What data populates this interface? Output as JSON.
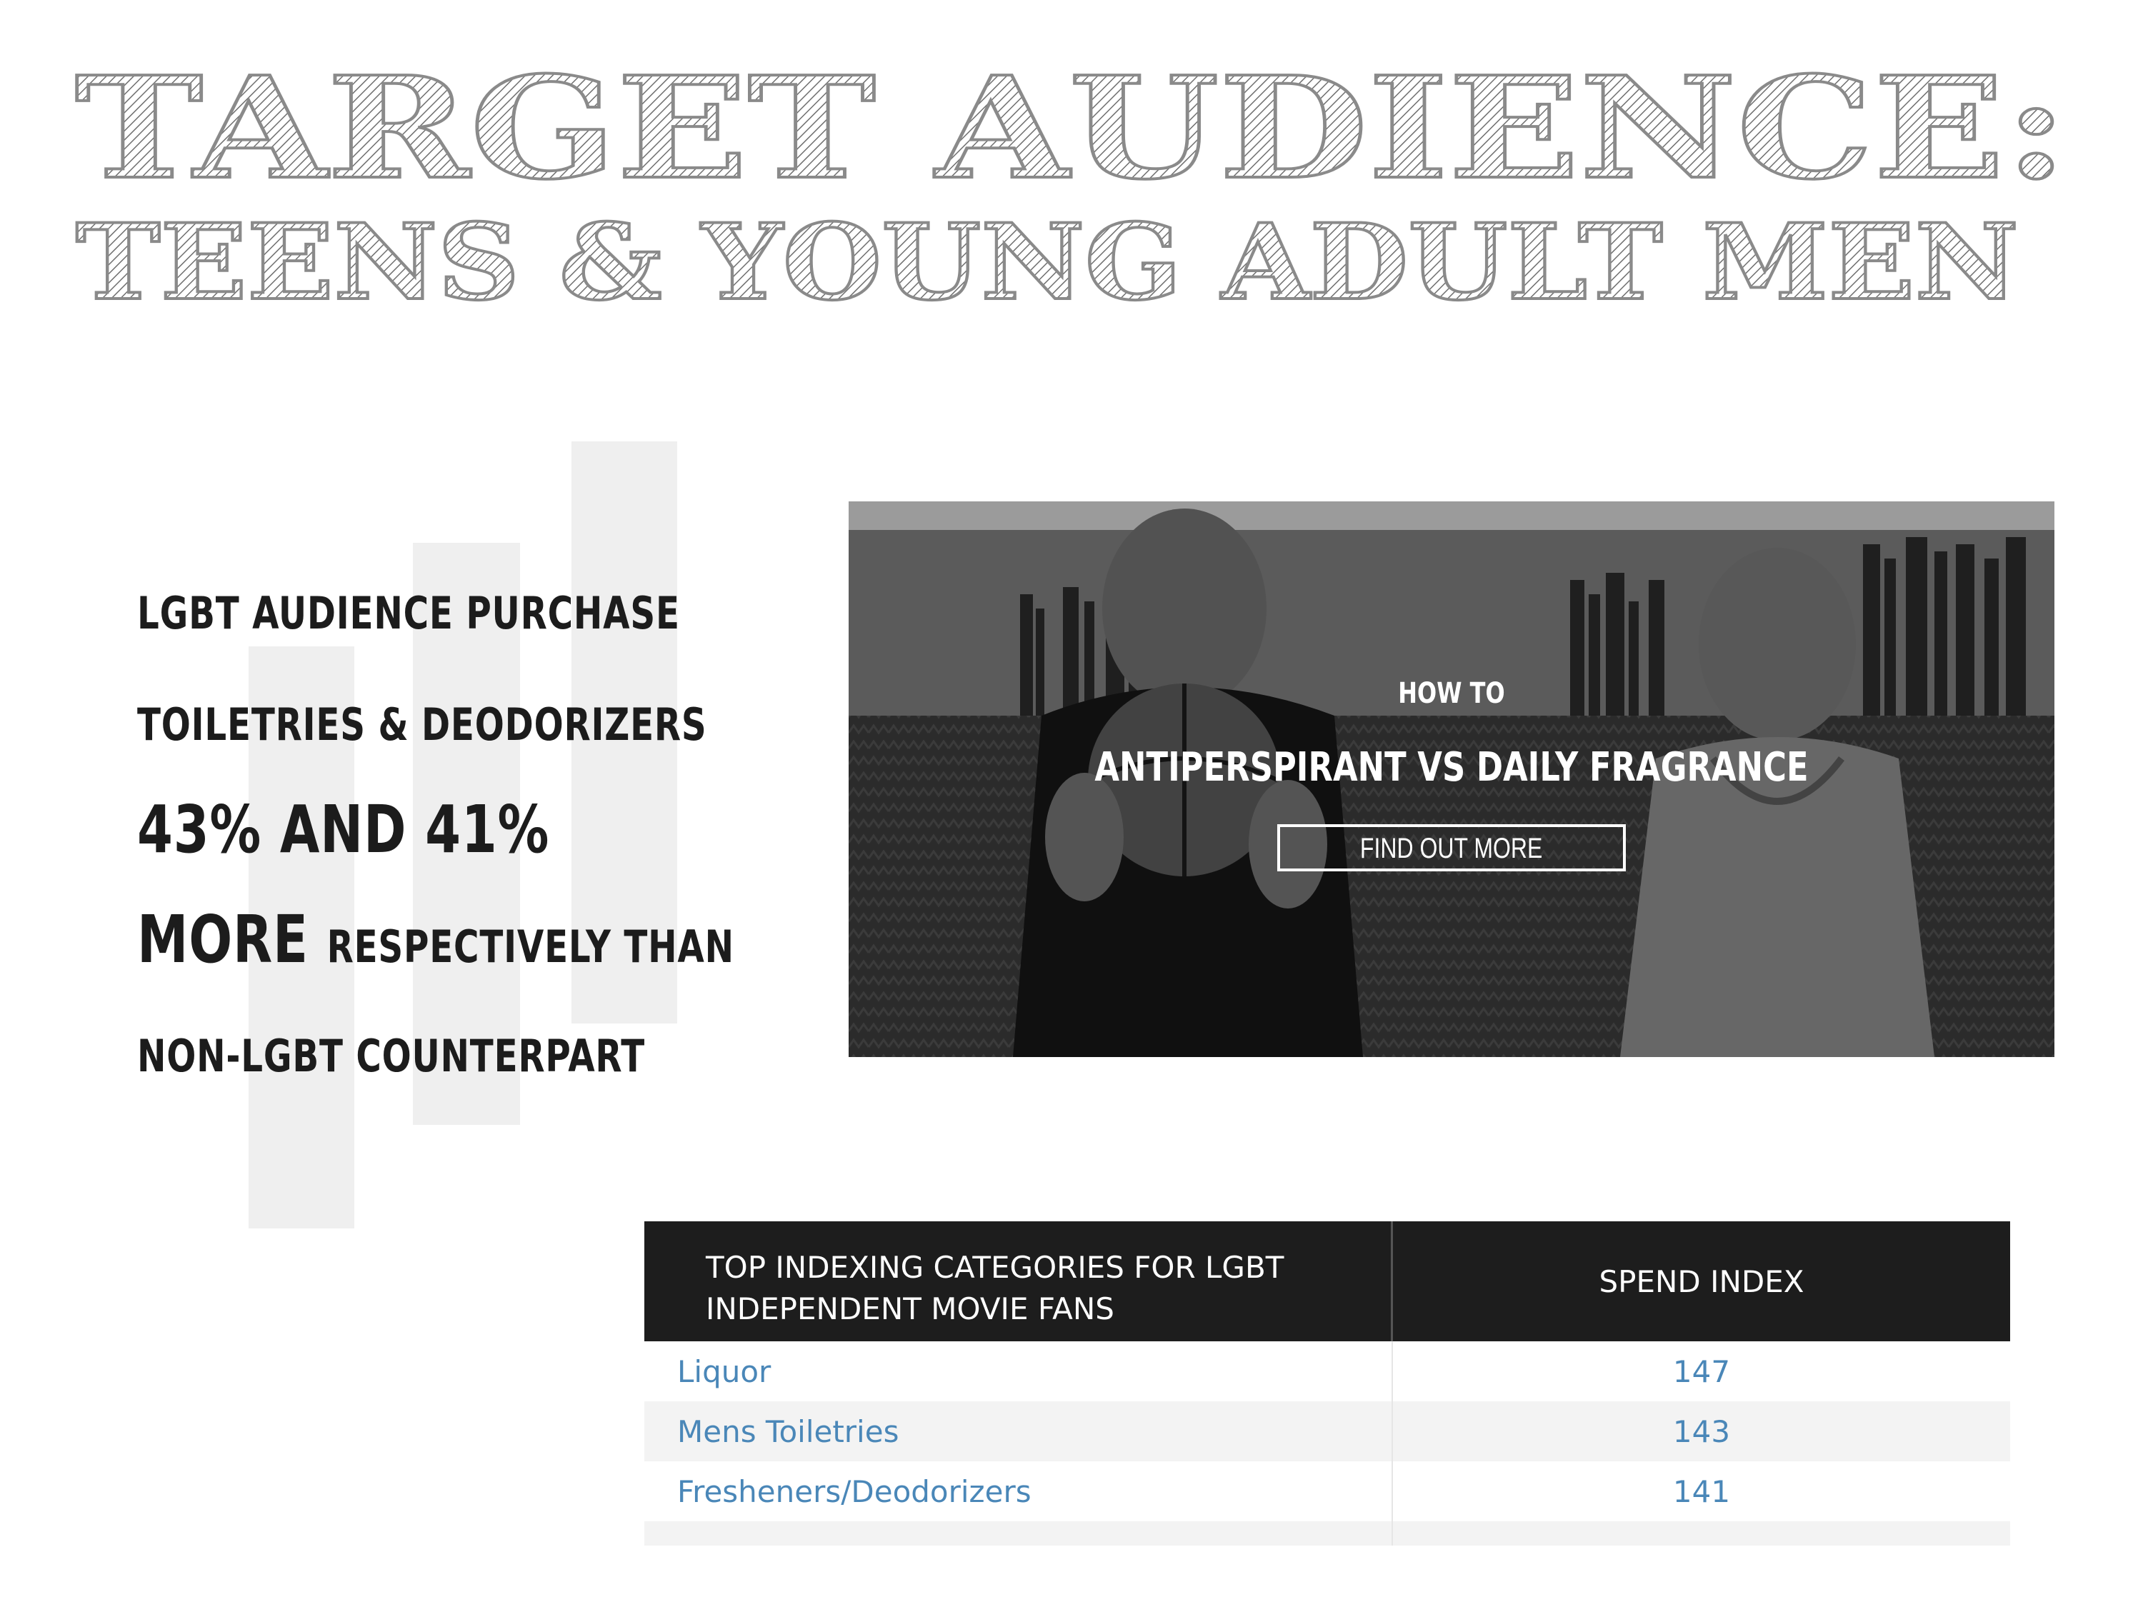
{
  "title": {
    "line1": "TARGET AUDIENCE:",
    "line2": "TEENS & YOUNG ADULT MEN"
  },
  "stat": {
    "line1": "LGBT AUDIENCE PURCHASE",
    "line2": "TOILETRIES & DEODORIZERS",
    "line3": "43% AND 41%",
    "line4_big": "MORE",
    "line4_small": "RESPECTIVELY THAN",
    "line5": "NON-LGBT COUNTERPART"
  },
  "banner": {
    "kicker": "HOW TO",
    "headline": "ANTIPERSPIRANT VS DAILY FRAGRANCE",
    "button_label": "FIND OUT MORE"
  },
  "table": {
    "header_category": "TOP INDEXING CATEGORIES FOR LGBT INDEPENDENT MOVIE FANS",
    "header_category_line1": "TOP INDEXING CATEGORIES FOR LGBT",
    "header_category_line2": "INDEPENDENT MOVIE FANS",
    "header_index": "SPEND INDEX",
    "rows": [
      {
        "category": "Liquor",
        "index": "147"
      },
      {
        "category": "Mens Toiletries",
        "index": "143"
      },
      {
        "category": "Fresheners/Deodorizers",
        "index": "141"
      }
    ]
  },
  "colors": {
    "table_header_bg": "#1d1d1d",
    "table_text": "#4a87b8",
    "stat_text": "#1c1c1c"
  }
}
